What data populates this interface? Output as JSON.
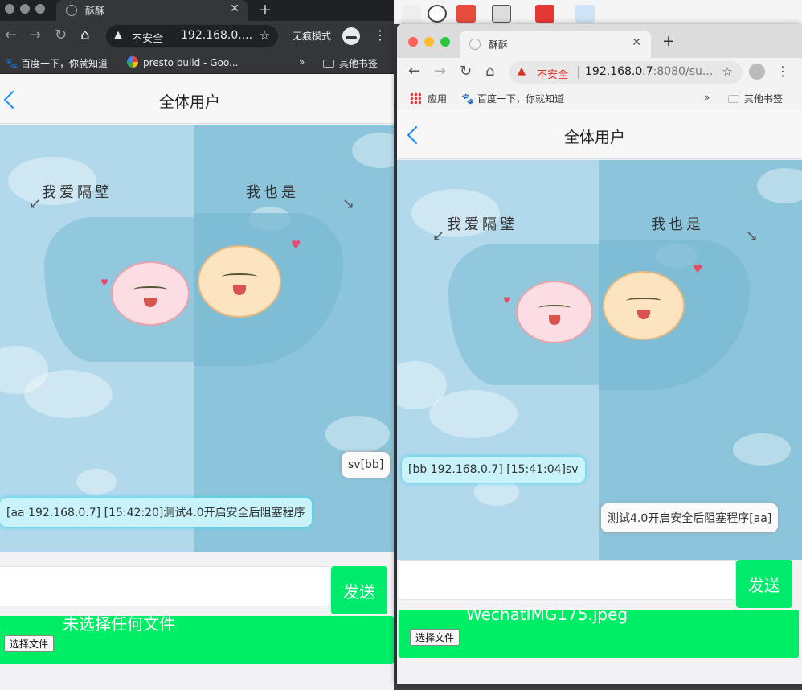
{
  "left_browser": {
    "tab_title": "酥酥",
    "omnibox": {
      "warning": "不安全",
      "url": "192.168.0...."
    },
    "incognito_label": "无痕模式",
    "bookmarks": [
      "百度一下，你就知道",
      "presto build - Goo...",
      "»",
      "其他书签"
    ],
    "page": {
      "title": "全体用户",
      "bg_caption_left": "我爱隔壁",
      "bg_caption_right": "我也是",
      "messages": [
        {
          "text": "sv[bb]",
          "direction": "out"
        },
        {
          "text": "[aa 192.168.0.7] [15:42:20]测试4.0开启安全后阻塞程序",
          "direction": "in"
        }
      ],
      "send_label": "发送",
      "file_button_label": "选择文件",
      "file_name": "未选择任何文件"
    }
  },
  "right_browser": {
    "tab_title": "酥酥",
    "omnibox": {
      "warning": "不安全",
      "url_host": "192.168.0.7",
      "url_rest": ":8080/su..."
    },
    "bookmarks": [
      "应用",
      "百度一下，你就知道",
      "»",
      "其他书签"
    ],
    "page": {
      "title": "全体用户",
      "bg_caption_left": "我爱隔壁",
      "bg_caption_right": "我也是",
      "messages": [
        {
          "text": "[bb 192.168.0.7] [15:41:04]sv",
          "direction": "in"
        },
        {
          "text": "测试4.0开启安全后阻塞程序[aa]",
          "direction": "out"
        }
      ],
      "send_label": "发送",
      "file_button_label": "选择文件",
      "file_name": "WechatIMG175.jpeg"
    }
  },
  "colors": {
    "send_green": "#00ea6b",
    "incoming_bubble": "#c9f3fb",
    "outgoing_bubble": "#fafafa",
    "back_blue": "#1a8cff",
    "insecure_red": "#d93025"
  }
}
